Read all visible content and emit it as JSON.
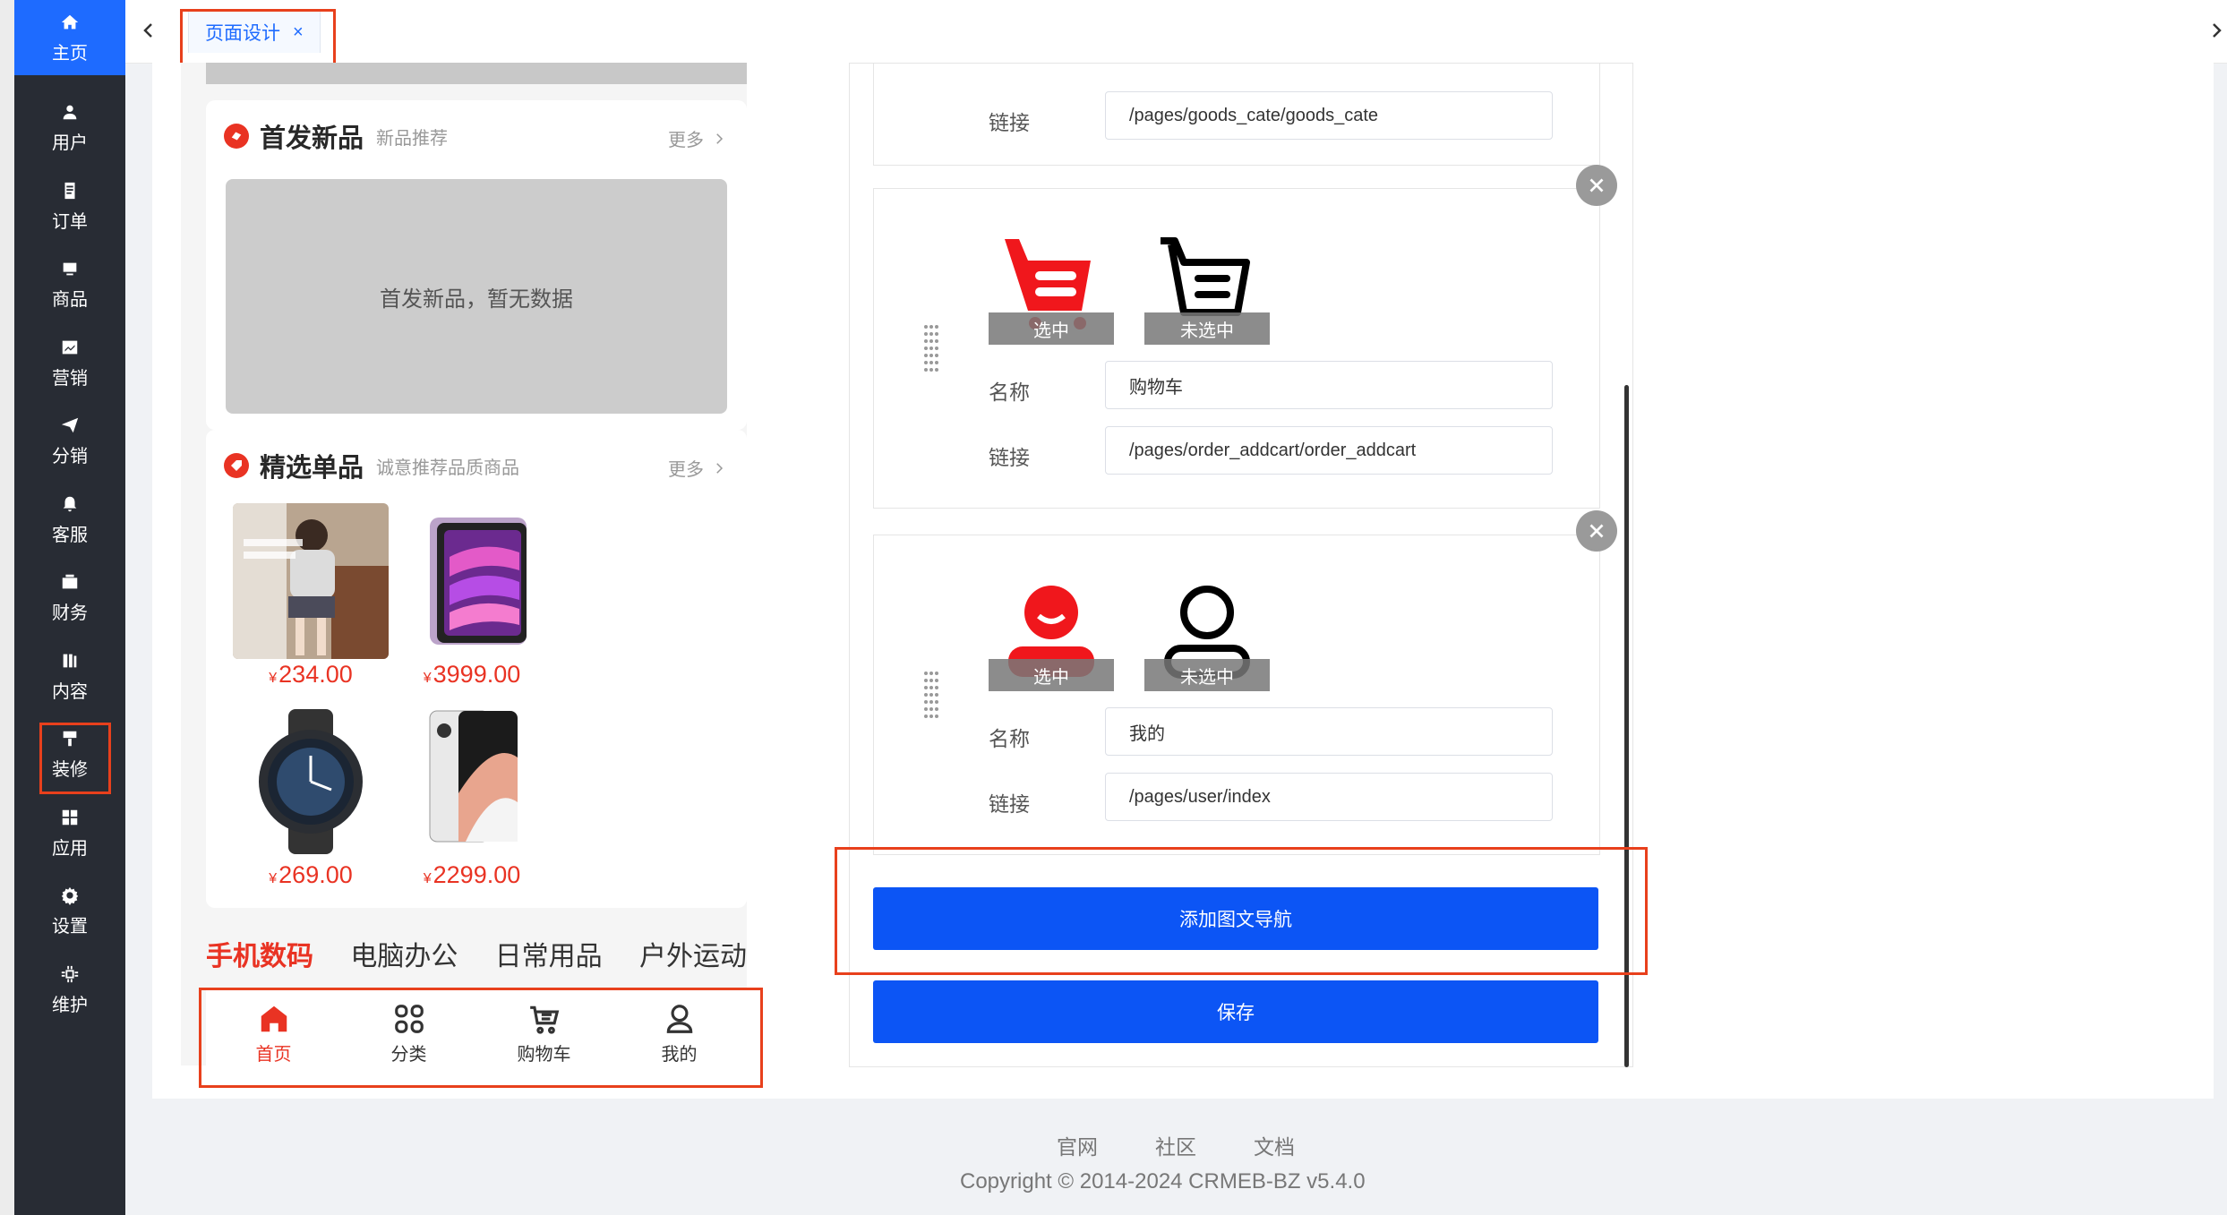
{
  "sidebar": {
    "items": [
      {
        "label": "主页",
        "icon": "home-icon"
      },
      {
        "label": "用户",
        "icon": "user-icon"
      },
      {
        "label": "订单",
        "icon": "order-icon"
      },
      {
        "label": "商品",
        "icon": "goods-icon"
      },
      {
        "label": "营销",
        "icon": "marketing-icon"
      },
      {
        "label": "分销",
        "icon": "distribution-icon"
      },
      {
        "label": "客服",
        "icon": "service-icon"
      },
      {
        "label": "财务",
        "icon": "finance-icon"
      },
      {
        "label": "内容",
        "icon": "content-icon"
      },
      {
        "label": "装修",
        "icon": "decoration-icon"
      },
      {
        "label": "应用",
        "icon": "apps-icon"
      },
      {
        "label": "设置",
        "icon": "settings-icon"
      },
      {
        "label": "维护",
        "icon": "maintenance-icon"
      }
    ]
  },
  "tabs": {
    "active_label": "页面设计",
    "close_glyph": "×"
  },
  "preview": {
    "new_products": {
      "title": "首发新品",
      "subtitle": "新品推荐",
      "more": "更多",
      "empty_text": "首发新品，暂无数据"
    },
    "selected": {
      "title": "精选单品",
      "subtitle": "诚意推荐品质商品",
      "more": "更多",
      "currency": "¥",
      "products": [
        {
          "price": "234.00"
        },
        {
          "price": "3999.00"
        },
        {
          "price": "269.00"
        },
        {
          "price": "2299.00"
        }
      ]
    },
    "categories": [
      "手机数码",
      "电脑办公",
      "日常用品",
      "户外运动"
    ],
    "tabbar": [
      {
        "label": "首页",
        "icon": "home-icon"
      },
      {
        "label": "分类",
        "icon": "category-icon"
      },
      {
        "label": "购物车",
        "icon": "cart-icon"
      },
      {
        "label": "我的",
        "icon": "profile-icon"
      }
    ]
  },
  "settings": {
    "top_card": {
      "link_label": "链接",
      "link_value": "/pages/goods_cate/goods_cate"
    },
    "nav_items": [
      {
        "selected_caption": "选中",
        "unselected_caption": "未选中",
        "name_label": "名称",
        "name_value": "购物车",
        "link_label": "链接",
        "link_value": "/pages/order_addcart/order_addcart"
      },
      {
        "selected_caption": "选中",
        "unselected_caption": "未选中",
        "name_label": "名称",
        "name_value": "我的",
        "link_label": "链接",
        "link_value": "/pages/user/index"
      }
    ],
    "add_button": "添加图文导航",
    "save_button": "保存"
  },
  "footer": {
    "links": [
      "官网",
      "社区",
      "文档"
    ],
    "copyright": "Copyright © 2014-2024 CRMEB-BZ v5.4.0"
  },
  "colors": {
    "sidebar_bg": "#282c34",
    "sidebar_active": "#1e6bff",
    "brand_red": "#e93323",
    "primary_button": "#0c55f5",
    "highlight": "#e8401c"
  }
}
